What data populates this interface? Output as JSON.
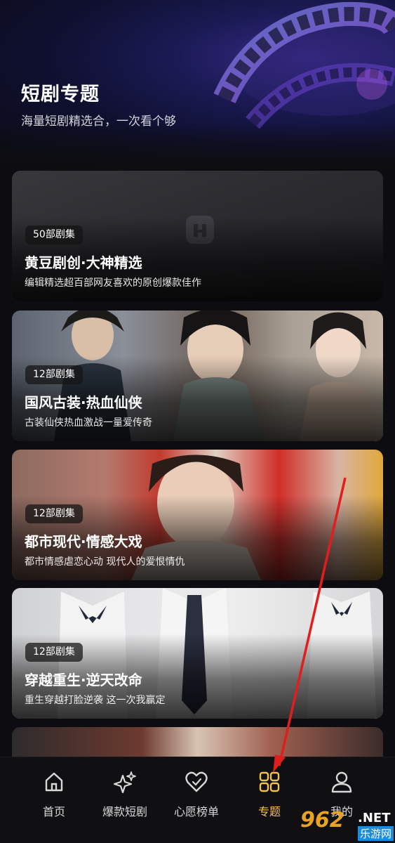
{
  "header": {
    "title": "短剧专题",
    "subtitle": "海量短剧精选合，一次看个够"
  },
  "cards": [
    {
      "badge": "50部剧集",
      "title": "黄豆剧创·大神精选",
      "desc": "编辑精选超百部网友喜欢的原创爆款佳作"
    },
    {
      "badge": "12部剧集",
      "title": "国风古装·热血仙侠",
      "desc": "古装仙侠热血激战一量爱传奇"
    },
    {
      "badge": "12部剧集",
      "title": "都市现代·情感大戏",
      "desc": "都市情感虐恋心动 现代人的爱恨情仇"
    },
    {
      "badge": "12部剧集",
      "title": "穿越重生·逆天改命",
      "desc": "重生穿越打脸逆袭 这一次我赢定"
    }
  ],
  "tabbar": {
    "items": [
      {
        "label": "首页",
        "icon": "home-icon"
      },
      {
        "label": "爆款短剧",
        "icon": "sparkle-icon"
      },
      {
        "label": "心愿榜单",
        "icon": "heart-icon"
      },
      {
        "label": "专题",
        "icon": "grid-icon",
        "active": true
      },
      {
        "label": "我的",
        "icon": "user-icon"
      }
    ],
    "active_color": "#f2c14e"
  },
  "watermark": {
    "logo": "962",
    "net": ".NET",
    "sub": "乐游网"
  }
}
